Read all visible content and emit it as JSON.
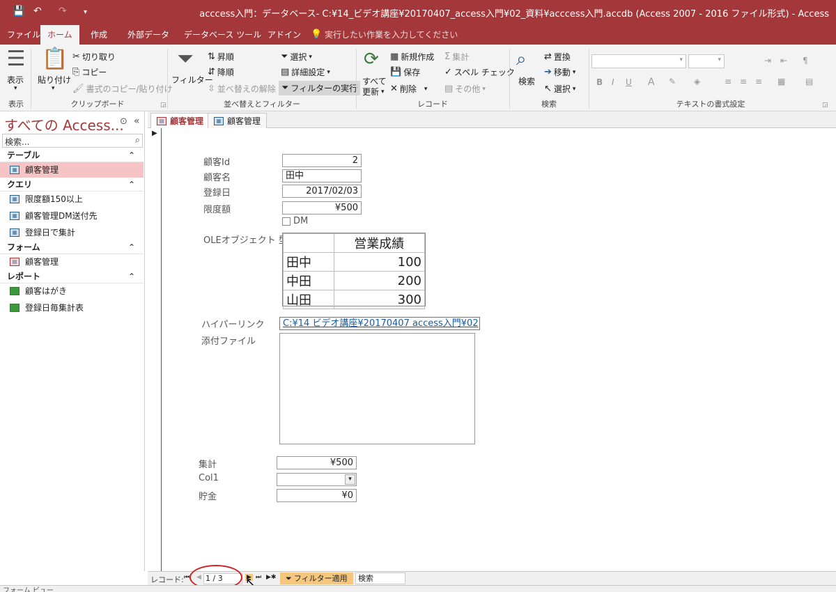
{
  "titlebar": {
    "save_icon": "save-icon",
    "undo_icon": "undo-icon",
    "redo_icon": "redo-icon",
    "title": "acccess入門：データベース- C:¥14_ビデオ講座¥20170407_access入門¥02_資料¥acccess入門.accdb (Access 2007 - 2016 ファイル形式)  -  Access"
  },
  "ribbon_tabs": [
    "ファイル",
    "ホーム",
    "作成",
    "外部データ",
    "データベース ツール",
    "アドイン",
    "実行したい作業を入力してください"
  ],
  "ribbon": {
    "view": {
      "label": "表示",
      "group": "表示"
    },
    "clipboard": {
      "paste": "貼り付け",
      "cut": "切り取り",
      "copy": "コピー",
      "format_painter": "書式のコピー/貼り付け",
      "group": "クリップボード"
    },
    "sort_filter": {
      "filter": "フィルター",
      "ascending": "昇順",
      "descending": "降順",
      "remove_sort": "並べ替えの解除",
      "selection": "選択",
      "advanced": "詳細設定",
      "toggle_filter": "フィルターの実行",
      "group": "並べ替えとフィルター"
    },
    "records": {
      "refresh_all": "すべて",
      "refresh_all2": "更新",
      "new": "新規作成",
      "save": "保存",
      "delete": "削除",
      "totals": "集計",
      "spelling": "スペル チェック",
      "more": "その他",
      "group": "レコード"
    },
    "find": {
      "find": "検索",
      "replace": "置換",
      "goto": "移動",
      "select": "選択",
      "group": "検索"
    },
    "text_format": {
      "bold": "B",
      "italic": "I",
      "underline": "U",
      "font_color": "A",
      "group": "テキストの書式設定"
    }
  },
  "nav": {
    "title": "すべての Access...",
    "search_placeholder": "検索...",
    "sections": [
      {
        "label": "テーブル",
        "items": [
          "顧客管理"
        ]
      },
      {
        "label": "クエリ",
        "items": [
          "限度額150以上",
          "顧客管理DM送付先",
          "登録日で集計"
        ]
      },
      {
        "label": "フォーム",
        "items": [
          "顧客管理"
        ]
      },
      {
        "label": "レポート",
        "items": [
          "顧客はがき",
          "登録日毎集計表"
        ]
      }
    ],
    "collapse": "«",
    "chevron": "⌃"
  },
  "doc_tabs": [
    "顧客管理",
    "顧客管理"
  ],
  "form": {
    "fields": [
      {
        "label": "顧客Id",
        "value": "2"
      },
      {
        "label": "顧客名",
        "value": "田中"
      },
      {
        "label": "登録日",
        "value": "2017/02/03"
      },
      {
        "label": "限度額",
        "value": "¥500"
      }
    ],
    "dm_label": "DM",
    "ole_label": "OLEオブジェクト 型",
    "ole_table": {
      "header": "営業成績",
      "rows": [
        {
          "name": "田中",
          "value": "100"
        },
        {
          "name": "中田",
          "value": "200"
        },
        {
          "name": "山田",
          "value": "300"
        }
      ]
    },
    "hyperlink_label": "ハイパーリンク",
    "hyperlink_value": "C:¥14 ビデオ講座¥20170407 access入門¥02",
    "attachment_label": "添付ファイル",
    "total_label": "集計",
    "total_value": "¥500",
    "col1_label": "Col1",
    "col1_value": "",
    "savings_label": "貯金",
    "savings_value": "¥0"
  },
  "record_nav": {
    "label": "レコード:",
    "position": "1 / 3",
    "filter_label": "フィルター適用",
    "search": "検索"
  },
  "status": {
    "view": "フォーム ビュー"
  }
}
